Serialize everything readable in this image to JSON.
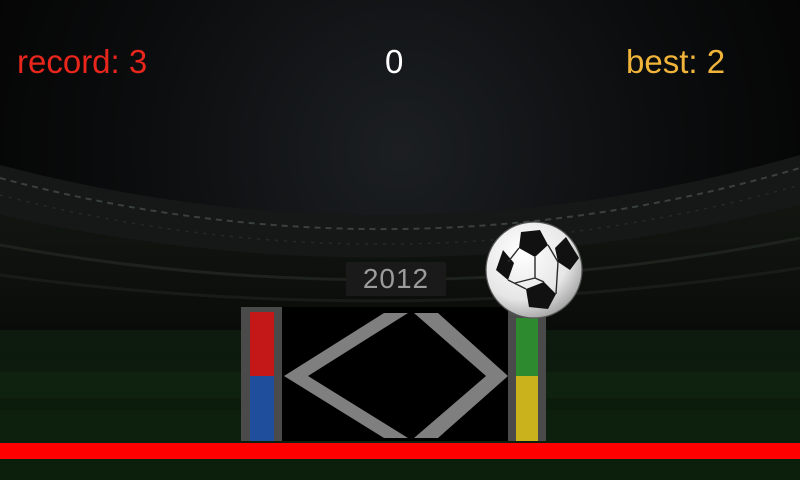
{
  "hud": {
    "record_label": "record: 3",
    "score": "0",
    "best_label": "best: 2"
  },
  "scene": {
    "year": "2012"
  },
  "colors": {
    "record": "#e8261c",
    "score": "#ffffff",
    "best": "#f0b43a",
    "ground_line": "#ff0000",
    "left_post_top": "#c41717",
    "left_post_bottom": "#1f4f9c",
    "right_post_top": "#2e8a2e",
    "right_post_bottom": "#c9b21c"
  },
  "controls": {
    "left_icon": "left-chevron-icon",
    "right_icon": "right-chevron-icon"
  }
}
